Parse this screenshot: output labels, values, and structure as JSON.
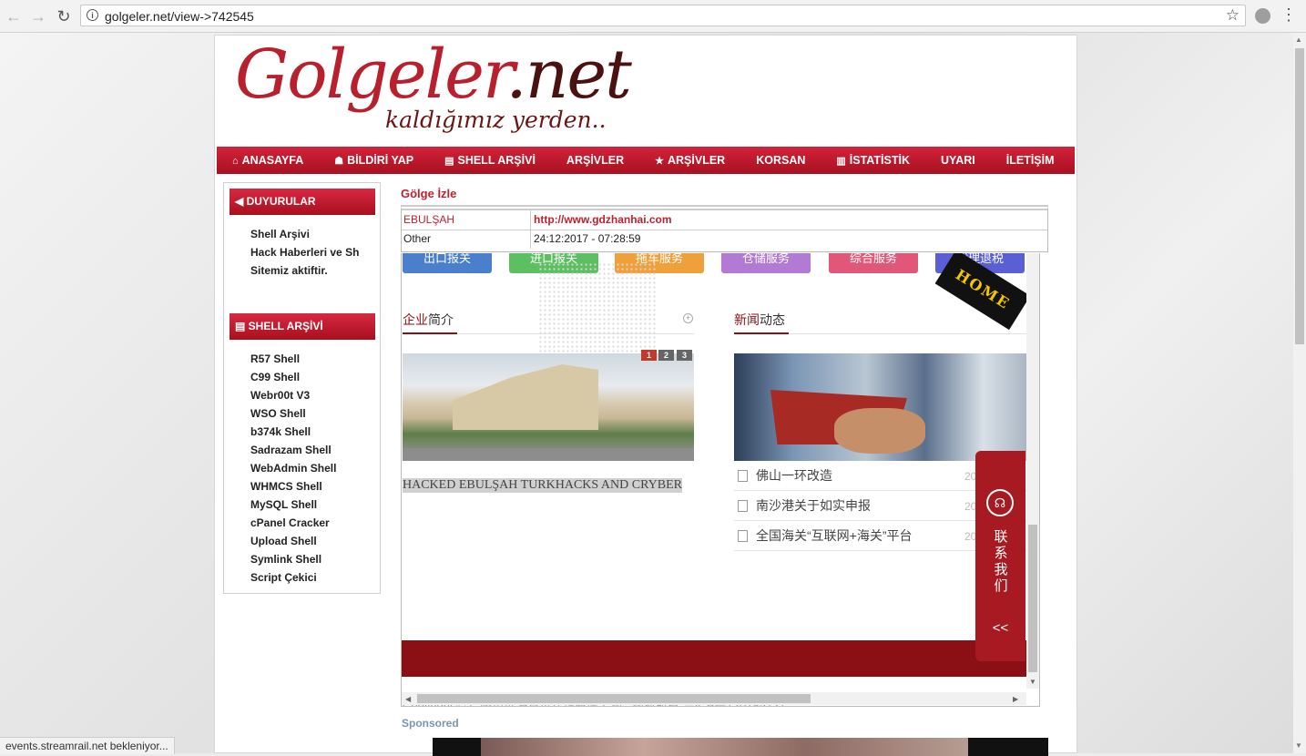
{
  "browser": {
    "url": "golgeler.net/view->742545"
  },
  "logo": {
    "main": "Golgeler",
    "suffix": ".net",
    "tagline": "kaldığımız yerden.."
  },
  "menu": [
    {
      "label": "ANASAYFA",
      "icon": "home-icon",
      "glyph": "⌂"
    },
    {
      "label": "BİLDİRİ YAP",
      "icon": "user-icon",
      "glyph": "☗"
    },
    {
      "label": "SHELL ARŞİVİ",
      "icon": "file-icon",
      "glyph": "▤"
    },
    {
      "label": "ARŞİVLER",
      "icon": "",
      "glyph": ""
    },
    {
      "label": "ARŞİVLER",
      "icon": "star-icon",
      "glyph": "★"
    },
    {
      "label": "KORSAN",
      "icon": "",
      "glyph": ""
    },
    {
      "label": "İSTATİSTİK",
      "icon": "bar-chart-icon",
      "glyph": "▥"
    },
    {
      "label": "UYARI",
      "icon": "",
      "glyph": ""
    },
    {
      "label": "İLETİŞİM",
      "icon": "",
      "glyph": ""
    }
  ],
  "sidebar": {
    "announcements_title": "DUYURULAR",
    "announcements": [
      "Shell Arşivi",
      "Hack Haberleri ve Sh",
      "Sitemiz aktiftir."
    ],
    "shell_title": "SHELL ARŞİVİ",
    "shells": [
      "R57 Shell",
      "C99 Shell",
      "Webr00t V3",
      "WSO Shell",
      "b374k Shell",
      "Sadrazam Shell",
      "WebAdmin Shell",
      "WHMCS Shell",
      "MySQL Shell",
      "cPanel Cracker",
      "Upload Shell",
      "Symlink Shell",
      "Script Çekici"
    ]
  },
  "main": {
    "title": "Gölge İzle",
    "row1": {
      "attacker": "EBULŞAH",
      "url": "http://www.gdzhanhai.com"
    },
    "row2": {
      "type": "Other",
      "date": "24:12:2017 - 07:28:59"
    }
  },
  "frame": {
    "services": [
      {
        "label": "出口报关",
        "color": "#4a7fcc"
      },
      {
        "label": "进口报关",
        "color": "#5cc063"
      },
      {
        "label": "拖车服务",
        "color": "#f0a03a"
      },
      {
        "label": "仓储服务",
        "color": "#b27ad4"
      },
      {
        "label": "综合服务",
        "color": "#e0577a"
      },
      {
        "label": "代理退税",
        "color": "#5a5fd6"
      }
    ],
    "about_red": "企业",
    "about_rest": "简介",
    "news_red": "新闻",
    "news_rest": "动态",
    "pages": [
      "1",
      "2",
      "3"
    ],
    "hacked_text": "HACKED EBULŞAH TURKHACKS AND CRYBER",
    "news": [
      {
        "title": "佛山一环改造",
        "date": "20"
      },
      {
        "title": "南沙港关于如实申报",
        "date": "20"
      },
      {
        "title": "全国海关“互联网+海关”平台",
        "date": "20"
      }
    ],
    "home_tag": "HOME",
    "contact_label": "联系我们",
    "contact_back": "<<",
    "copyright": "Copyright © 广州市展海货运代理有限公司 . 版权所有 粤ICP备12078572号"
  },
  "sponsored": "Sponsored",
  "status_text": "events.streamrail.net bekleniyor..."
}
